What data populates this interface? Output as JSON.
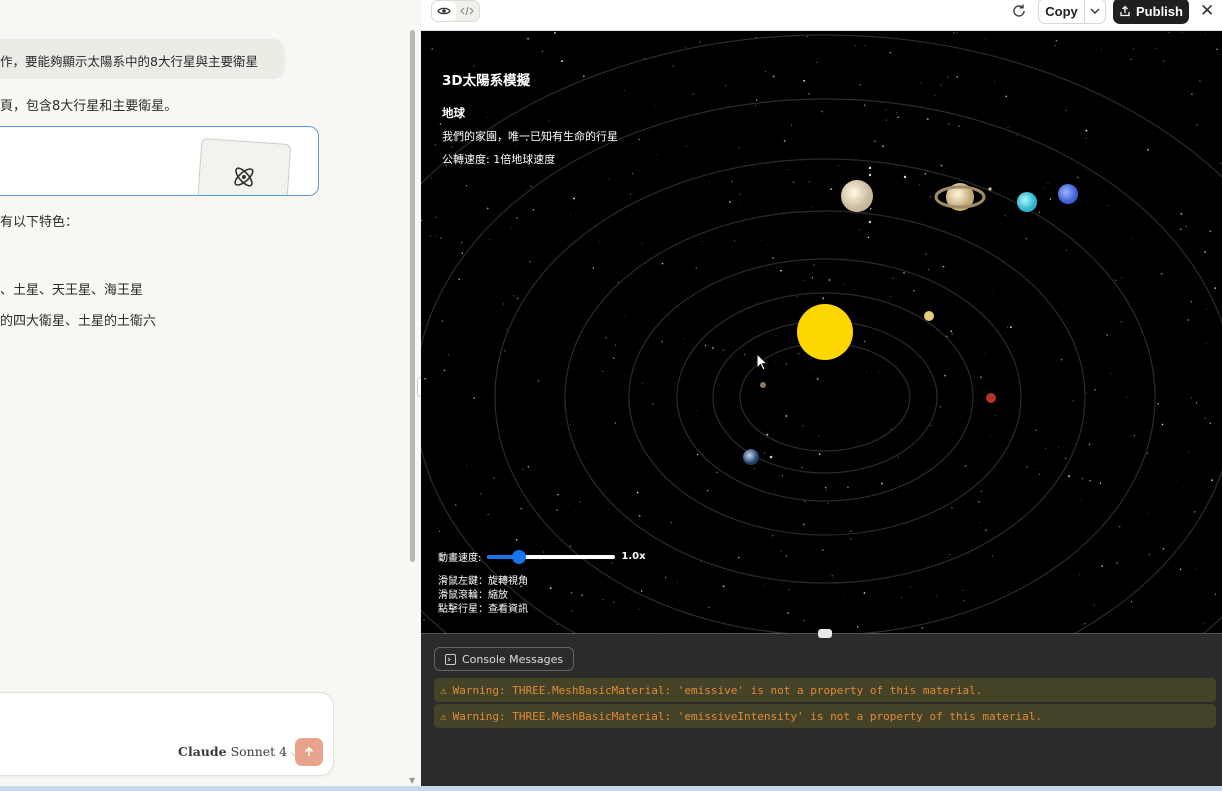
{
  "chat": {
    "user_message": "作，要能夠顯示太陽系中的8大行星與主要衛星",
    "reply_intro": "頁，包含8大行星和主要衛星。",
    "features_intro": "有以下特色：",
    "planets_line": "、土星、天王星、海王星",
    "moons_line": "的四大衛星、土星的土衛六"
  },
  "composer": {
    "model_brand": "Claude",
    "model_name": "Sonnet 4",
    "send_icon": "arrow-up-icon"
  },
  "toolbar": {
    "preview_icon": "eye-icon",
    "code_icon": "code-icon",
    "refresh_icon": "refresh-icon",
    "copy_label": "Copy",
    "publish_label": "Publish",
    "close_icon": "close-icon"
  },
  "simulation": {
    "title": "3D太陽系模擬",
    "planet_name": "地球",
    "planet_description": "我們的家園，唯一已知有生命的行星",
    "orbit_speed": "公轉速度: 1倍地球速度",
    "speed_label": "動畫速度:",
    "speed_value": "1.0x",
    "speed_level_percent": 25,
    "help": [
      "滑鼠左鍵：旋轉視角",
      "滑鼠滾輪：縮放",
      "點擊行星：查看資訊"
    ]
  },
  "console": {
    "tab_label": "Console Messages",
    "warnings": [
      "Warning: THREE.MeshBasicMaterial: 'emissive' is not a property of this material.",
      "Warning: THREE.MeshBasicMaterial: 'emissiveIntensity' is not a property of this material."
    ]
  },
  "colors": {
    "accent_blue": "#1a73e8",
    "sun": "#ffd700",
    "warning_text": "#e0883a",
    "send_button": "#e8a38c"
  }
}
